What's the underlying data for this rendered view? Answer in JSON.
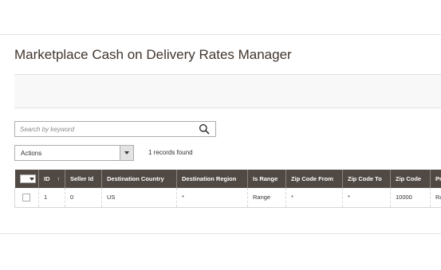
{
  "page": {
    "title": "Marketplace Cash on Delivery Rates Manager"
  },
  "search": {
    "placeholder": "Search by keyword",
    "icon": "search-icon"
  },
  "actions": {
    "label": "Actions"
  },
  "records_found": "1 records found",
  "grid": {
    "columns": [
      {
        "label": ""
      },
      {
        "label": "ID",
        "sort": "↑"
      },
      {
        "label": "Seller Id"
      },
      {
        "label": "Destination Country"
      },
      {
        "label": "Destination Region"
      },
      {
        "label": "Is Range"
      },
      {
        "label": "Zip Code From"
      },
      {
        "label": "Zip Code To"
      },
      {
        "label": "Zip Code"
      },
      {
        "label": "Pri"
      }
    ],
    "rows": [
      {
        "id": "1",
        "seller_id": "0",
        "country": "US",
        "region": "*",
        "is_range": "Range",
        "zip_from": "*",
        "zip_to": "*",
        "zip_code": "10000",
        "price": "Ran"
      }
    ]
  },
  "colors": {
    "header_bg": "#514943",
    "header_text": "#ffffff",
    "title_text": "#41362f",
    "action_bar_bg": "#f8f8f8"
  }
}
